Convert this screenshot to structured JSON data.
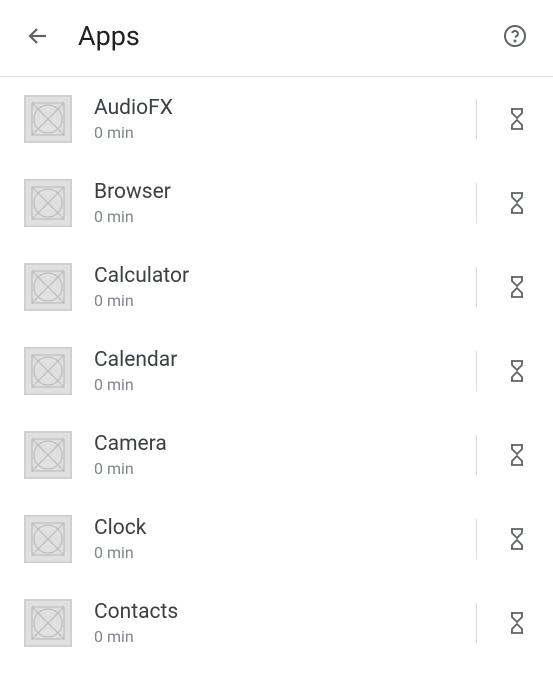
{
  "header": {
    "title": "Apps"
  },
  "apps": [
    {
      "name": "AudioFX",
      "usage": "0 min"
    },
    {
      "name": "Browser",
      "usage": "0 min"
    },
    {
      "name": "Calculator",
      "usage": "0 min"
    },
    {
      "name": "Calendar",
      "usage": "0 min"
    },
    {
      "name": "Camera",
      "usage": "0 min"
    },
    {
      "name": "Clock",
      "usage": "0 min"
    },
    {
      "name": "Contacts",
      "usage": "0 min"
    }
  ]
}
